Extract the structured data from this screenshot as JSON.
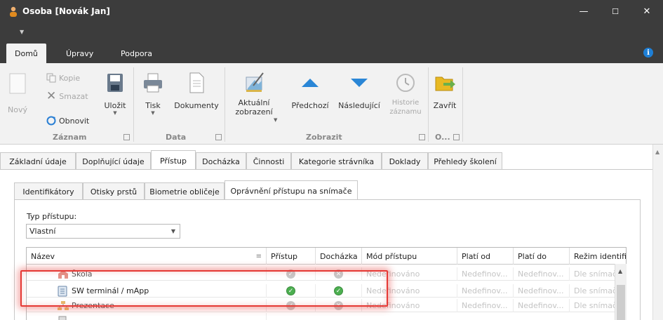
{
  "window": {
    "title": "Osoba [Novák Jan]",
    "minimize": "—",
    "maximize": "☐",
    "close": "✕"
  },
  "ribbon_tabs": [
    {
      "label": "Domů"
    },
    {
      "label": "Úpravy"
    },
    {
      "label": "Podpora"
    }
  ],
  "ribbon": {
    "zaznam": {
      "group": "Záznam",
      "new": "Nový",
      "copy": "Kopie",
      "delete": "Smazat",
      "refresh": "Obnovit",
      "save": "Uložit"
    },
    "data": {
      "group": "Data",
      "print": "Tisk",
      "documents": "Dokumenty"
    },
    "zobrazit": {
      "group": "Zobrazit",
      "current_view": "Aktuální\nzobrazení",
      "previous": "Předchozí",
      "next": "Následující",
      "history": "Historie\nzáznamu"
    },
    "other": {
      "group": "O...",
      "close": "Zavřít"
    }
  },
  "main_tabs": [
    {
      "label": "Základní údaje"
    },
    {
      "label": "Doplňující údaje"
    },
    {
      "label": "Přístup"
    },
    {
      "label": "Docházka"
    },
    {
      "label": "Činnosti"
    },
    {
      "label": "Kategorie strávníka"
    },
    {
      "label": "Doklady"
    },
    {
      "label": "Přehledy školení"
    }
  ],
  "sub_tabs": [
    {
      "label": "Identifikátory"
    },
    {
      "label": "Otisky prstů"
    },
    {
      "label": "Biometrie obličeje"
    },
    {
      "label": "Oprávnění přístupu na snímače"
    }
  ],
  "access_type": {
    "label": "Typ přístupu:",
    "value": "Vlastní"
  },
  "grid": {
    "headers": {
      "name": "Název",
      "access": "Přístup",
      "attendance": "Docházka",
      "mode": "Mód přístupu",
      "valid_from": "Platí od",
      "valid_to": "Platí do",
      "ident_mode": "Režim identifil"
    },
    "rows": [
      {
        "name": "Škola",
        "access": "ok",
        "attendance": "x",
        "mode": "Nedefinováno",
        "valid_from": "Nedefinov...",
        "valid_to": "Nedefinov...",
        "ident_mode": "Dle snímač",
        "dim": true
      },
      {
        "name": "SW terminál / mApp",
        "access": "ok",
        "attendance": "ok",
        "mode": "Nedefinováno",
        "valid_from": "Nedefinov...",
        "valid_to": "Nedefinov...",
        "ident_mode": "Dle snímač",
        "dim": false
      },
      {
        "name": "Prezentace",
        "access": "ok",
        "attendance": "x",
        "mode": "Nedefinováno",
        "valid_from": "Nedefinov...",
        "valid_to": "Nedefinov...",
        "ident_mode": "Dle snímač",
        "dim": true
      }
    ]
  },
  "colors": {
    "titlebar": "#3c3c3c",
    "ribbon": "#f2f2f2",
    "ok": "#4caf50",
    "highlight": "#e53935"
  }
}
